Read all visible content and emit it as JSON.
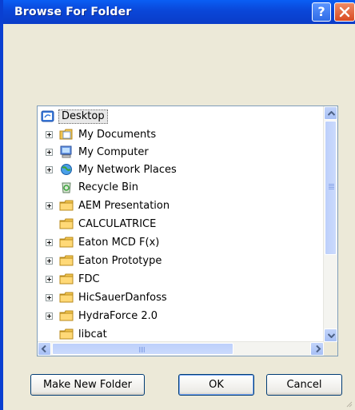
{
  "window": {
    "title": "Browse For Folder",
    "help_glyph": "?"
  },
  "tree": {
    "root": {
      "label": "Desktop",
      "icon": "desktop-icon"
    },
    "items": [
      {
        "label": "My Documents",
        "icon": "my-documents-icon",
        "expandable": true
      },
      {
        "label": "My Computer",
        "icon": "my-computer-icon",
        "expandable": true
      },
      {
        "label": "My Network Places",
        "icon": "network-places-icon",
        "expandable": true
      },
      {
        "label": "Recycle Bin",
        "icon": "recycle-bin-icon",
        "expandable": false
      },
      {
        "label": "AEM Presentation",
        "icon": "folder-icon",
        "expandable": true
      },
      {
        "label": "CALCULATRICE",
        "icon": "folder-icon",
        "expandable": false
      },
      {
        "label": "Eaton MCD F(x)",
        "icon": "folder-icon",
        "expandable": true
      },
      {
        "label": "Eaton Prototype",
        "icon": "folder-icon",
        "expandable": true
      },
      {
        "label": "FDC",
        "icon": "folder-icon",
        "expandable": true
      },
      {
        "label": "HicSauerDanfoss",
        "icon": "folder-icon",
        "expandable": true
      },
      {
        "label": "HydraForce 2.0",
        "icon": "folder-icon",
        "expandable": true
      },
      {
        "label": "libcat",
        "icon": "folder-icon",
        "expandable": false
      }
    ]
  },
  "buttons": {
    "make_new_folder": "Make New Folder",
    "ok": "OK",
    "cancel": "Cancel"
  },
  "colors": {
    "titlebar": "#0a46d8",
    "dialog_bg": "#ece9d8",
    "close_button": "#d94b22",
    "folder": "#f2c550"
  }
}
